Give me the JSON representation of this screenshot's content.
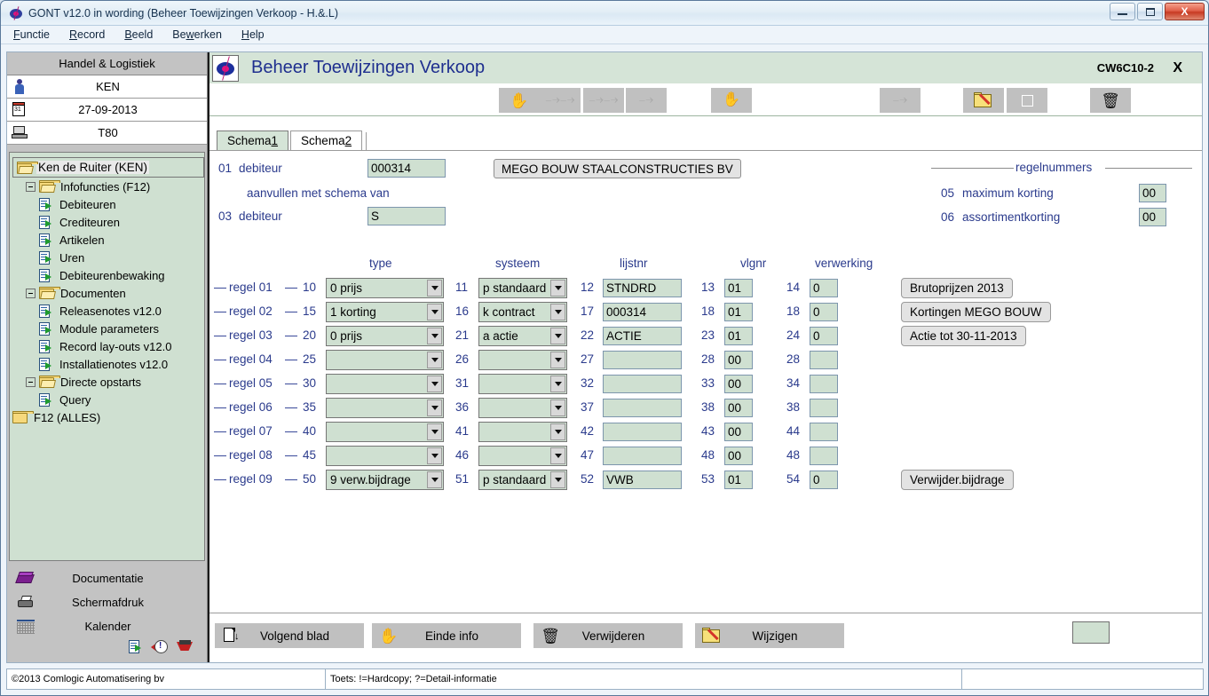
{
  "window": {
    "title": "GONT v12.0 in wording (Beheer Toewijzingen Verkoop - H.&.L)",
    "minimize_label": "",
    "maximize_label": "",
    "close_label": "X"
  },
  "menubar": [
    {
      "label": "Functie",
      "accel": "F"
    },
    {
      "label": "Record",
      "accel": "R"
    },
    {
      "label": "Beeld",
      "accel": "B"
    },
    {
      "label": "Bewerken",
      "accel": "w"
    },
    {
      "label": "Help",
      "accel": "H"
    }
  ],
  "sidebar": {
    "header": "Handel & Logistiek",
    "info_rows": [
      {
        "icon": "person-icon",
        "value": "KEN"
      },
      {
        "icon": "calendar-icon",
        "value": "27-09-2013"
      },
      {
        "icon": "terminal-icon",
        "value": "T80"
      }
    ],
    "tree": [
      {
        "label": "Ken de Ruiter (KEN)",
        "type": "folder-open",
        "indent": 0,
        "expander": false,
        "selected": true
      },
      {
        "label": "Infofuncties (F12)",
        "type": "folder-open",
        "indent": 1,
        "expander": true,
        "selected": false
      },
      {
        "label": "Debiteuren",
        "type": "doc",
        "indent": 2,
        "expander": false,
        "selected": false
      },
      {
        "label": "Crediteuren",
        "type": "doc",
        "indent": 2,
        "expander": false,
        "selected": false
      },
      {
        "label": "Artikelen",
        "type": "doc",
        "indent": 2,
        "expander": false,
        "selected": false
      },
      {
        "label": "Uren",
        "type": "doc",
        "indent": 2,
        "expander": false,
        "selected": false
      },
      {
        "label": "Debiteurenbewaking",
        "type": "doc",
        "indent": 2,
        "expander": false,
        "selected": false
      },
      {
        "label": "Documenten",
        "type": "folder-open",
        "indent": 1,
        "expander": true,
        "selected": false
      },
      {
        "label": "Releasenotes v12.0",
        "type": "doc",
        "indent": 2,
        "expander": false,
        "selected": false
      },
      {
        "label": "Module parameters",
        "type": "doc",
        "indent": 2,
        "expander": false,
        "selected": false
      },
      {
        "label": "Record lay-outs v12.0",
        "type": "doc",
        "indent": 2,
        "expander": false,
        "selected": false
      },
      {
        "label": "Installatienotes v12.0",
        "type": "doc",
        "indent": 2,
        "expander": false,
        "selected": false
      },
      {
        "label": "Directe opstarts",
        "type": "folder-open",
        "indent": 1,
        "expander": true,
        "selected": false
      },
      {
        "label": "Query",
        "type": "doc",
        "indent": 2,
        "expander": false,
        "selected": false
      },
      {
        "label": "F12 (ALLES)",
        "type": "folder",
        "indent": 0,
        "expander": false,
        "selected": false
      }
    ],
    "actions": [
      {
        "label": "Documentatie",
        "icon": "book-icon"
      },
      {
        "label": "Schermafdruk",
        "icon": "printer-icon"
      },
      {
        "label": "Kalender",
        "icon": "calendar-grid-icon"
      }
    ]
  },
  "form": {
    "title": "Beheer Toewijzingen Verkoop",
    "code": "CW6C10-2",
    "close": "X",
    "toolbar": [
      {
        "name": "hand-icon",
        "enabled": true
      },
      {
        "name": "first-record-icon",
        "enabled": false
      },
      {
        "name": "prev-record-icon",
        "enabled": false
      },
      {
        "name": "next-record-icon",
        "enabled": false
      },
      {
        "name": "query-icon",
        "enabled": false
      },
      {
        "name": "last-record-icon",
        "enabled": false
      },
      {
        "name": "edit-folder-icon",
        "enabled": true
      },
      {
        "name": "new-record-icon",
        "enabled": false
      },
      {
        "name": "delete-icon",
        "enabled": true
      },
      {
        "name": "binoculars-icon",
        "enabled": false
      },
      {
        "name": "help-icon",
        "enabled": true
      }
    ],
    "tabs": [
      {
        "label": "Schema ",
        "accel": "1",
        "active": true
      },
      {
        "label": "Schema ",
        "accel": "2",
        "active": false
      }
    ],
    "header_fields": {
      "debiteur_num": "01",
      "debiteur_label": "debiteur",
      "debiteur_value": "000314",
      "debiteur_name": "MEGO BOUW STAALCONSTRUCTIES BV",
      "aanvullen_label": "aanvullen met schema van",
      "debiteur2_num": "03",
      "debiteur2_label": "debiteur",
      "debiteur2_value": "S"
    },
    "regelnummers": {
      "legend": "regelnummers",
      "rows": [
        {
          "num": "05",
          "label": "maximum korting",
          "value": "00"
        },
        {
          "num": "06",
          "label": "assortimentkorting",
          "value": "00"
        }
      ]
    },
    "grid_headers": {
      "type": "type",
      "systeem": "systeem",
      "lijstnr": "lijstnr",
      "vlgnr": "vlgnr",
      "verwerking": "verwerking"
    },
    "grid_rows": [
      {
        "regel": "regel 01",
        "type_num": "10",
        "type": "0 prijs",
        "sys_num": "11",
        "systeem": "p standaard",
        "lijst_num": "12",
        "lijstnr": "STNDRD",
        "vlg_num": "13",
        "vlgnr": "01",
        "verw_num": "14",
        "verwerking": "0",
        "note": "Brutoprijzen 2013"
      },
      {
        "regel": "regel 02",
        "type_num": "15",
        "type": "1 korting",
        "sys_num": "16",
        "systeem": "k contract",
        "lijst_num": "17",
        "lijstnr": "000314",
        "vlg_num": "18",
        "vlgnr": "01",
        "verw_num": "18",
        "verwerking": "0",
        "note": "Kortingen MEGO BOUW"
      },
      {
        "regel": "regel 03",
        "type_num": "20",
        "type": "0 prijs",
        "sys_num": "21",
        "systeem": "a actie",
        "lijst_num": "22",
        "lijstnr": "ACTIE",
        "vlg_num": "23",
        "vlgnr": "01",
        "verw_num": "24",
        "verwerking": "0",
        "note": "Actie tot 30-11-2013"
      },
      {
        "regel": "regel 04",
        "type_num": "25",
        "type": "",
        "sys_num": "26",
        "systeem": "",
        "lijst_num": "27",
        "lijstnr": "",
        "vlg_num": "28",
        "vlgnr": "00",
        "verw_num": "28",
        "verwerking": "",
        "note": ""
      },
      {
        "regel": "regel 05",
        "type_num": "30",
        "type": "",
        "sys_num": "31",
        "systeem": "",
        "lijst_num": "32",
        "lijstnr": "",
        "vlg_num": "33",
        "vlgnr": "00",
        "verw_num": "34",
        "verwerking": "",
        "note": ""
      },
      {
        "regel": "regel 06",
        "type_num": "35",
        "type": "",
        "sys_num": "36",
        "systeem": "",
        "lijst_num": "37",
        "lijstnr": "",
        "vlg_num": "38",
        "vlgnr": "00",
        "verw_num": "38",
        "verwerking": "",
        "note": ""
      },
      {
        "regel": "regel 07",
        "type_num": "40",
        "type": "",
        "sys_num": "41",
        "systeem": "",
        "lijst_num": "42",
        "lijstnr": "",
        "vlg_num": "43",
        "vlgnr": "00",
        "verw_num": "44",
        "verwerking": "",
        "note": ""
      },
      {
        "regel": "regel 08",
        "type_num": "45",
        "type": "",
        "sys_num": "46",
        "systeem": "",
        "lijst_num": "47",
        "lijstnr": "",
        "vlg_num": "48",
        "vlgnr": "00",
        "verw_num": "48",
        "verwerking": "",
        "note": ""
      },
      {
        "regel": "regel 09",
        "type_num": "50",
        "type": "9 verw.bijdrage",
        "sys_num": "51",
        "systeem": "p standaard",
        "lijst_num": "52",
        "lijstnr": "VWB",
        "vlg_num": "53",
        "vlgnr": "01",
        "verw_num": "54",
        "verwerking": "0",
        "note": "Verwijder.bijdrage"
      }
    ],
    "bottom_buttons": [
      {
        "label": "Volgend blad",
        "icon": "page-down-icon"
      },
      {
        "label": "Einde info",
        "icon": "hand-icon"
      },
      {
        "label": "Verwijderen",
        "icon": "trash-icon"
      },
      {
        "label": "Wijzigen",
        "icon": "edit-folder-icon"
      }
    ],
    "end_field_value": ""
  },
  "statusbar": {
    "copyright": "©2013 Comlogic Automatisering bv",
    "hint": "Toets:  !=Hardcopy; ?=Detail-informatie",
    "right": ""
  },
  "colors": {
    "form_header": "#d5e4d7",
    "field_bg": "#cfe0d1",
    "label_blue": "#2a3a8c",
    "title_blue": "#1f2f8f"
  }
}
